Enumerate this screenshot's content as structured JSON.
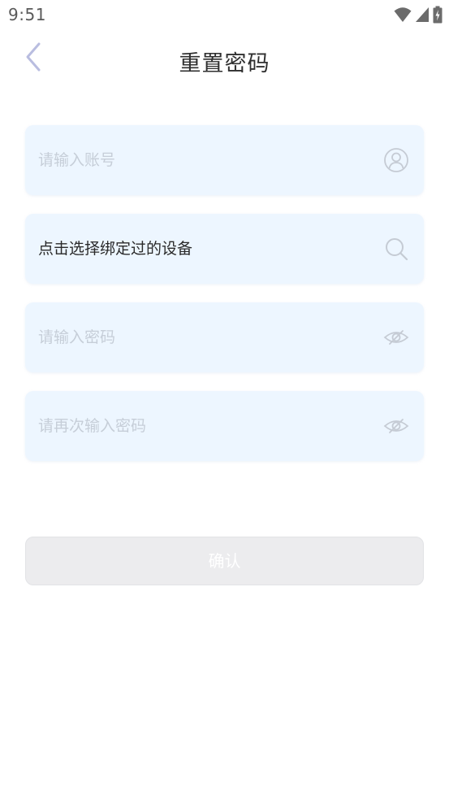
{
  "status_bar": {
    "time": "9:51"
  },
  "header": {
    "title": "重置密码"
  },
  "form": {
    "account": {
      "placeholder": "请输入账号"
    },
    "device": {
      "value": "点击选择绑定过的设备"
    },
    "password": {
      "placeholder": "请输入密码"
    },
    "confirm_password": {
      "placeholder": "请再次输入密码"
    }
  },
  "confirm_button": {
    "label": "确认"
  },
  "colors": {
    "field_bg": "#edf6ff",
    "placeholder": "#c6ced8",
    "icon": "#c5cbd4",
    "back_arrow": "#b9bde0",
    "button_disabled": "#ececee"
  },
  "icons": [
    "back-arrow-icon",
    "user-icon",
    "search-icon",
    "eye-off-icon",
    "wifi-icon",
    "signal-icon",
    "battery-icon"
  ]
}
